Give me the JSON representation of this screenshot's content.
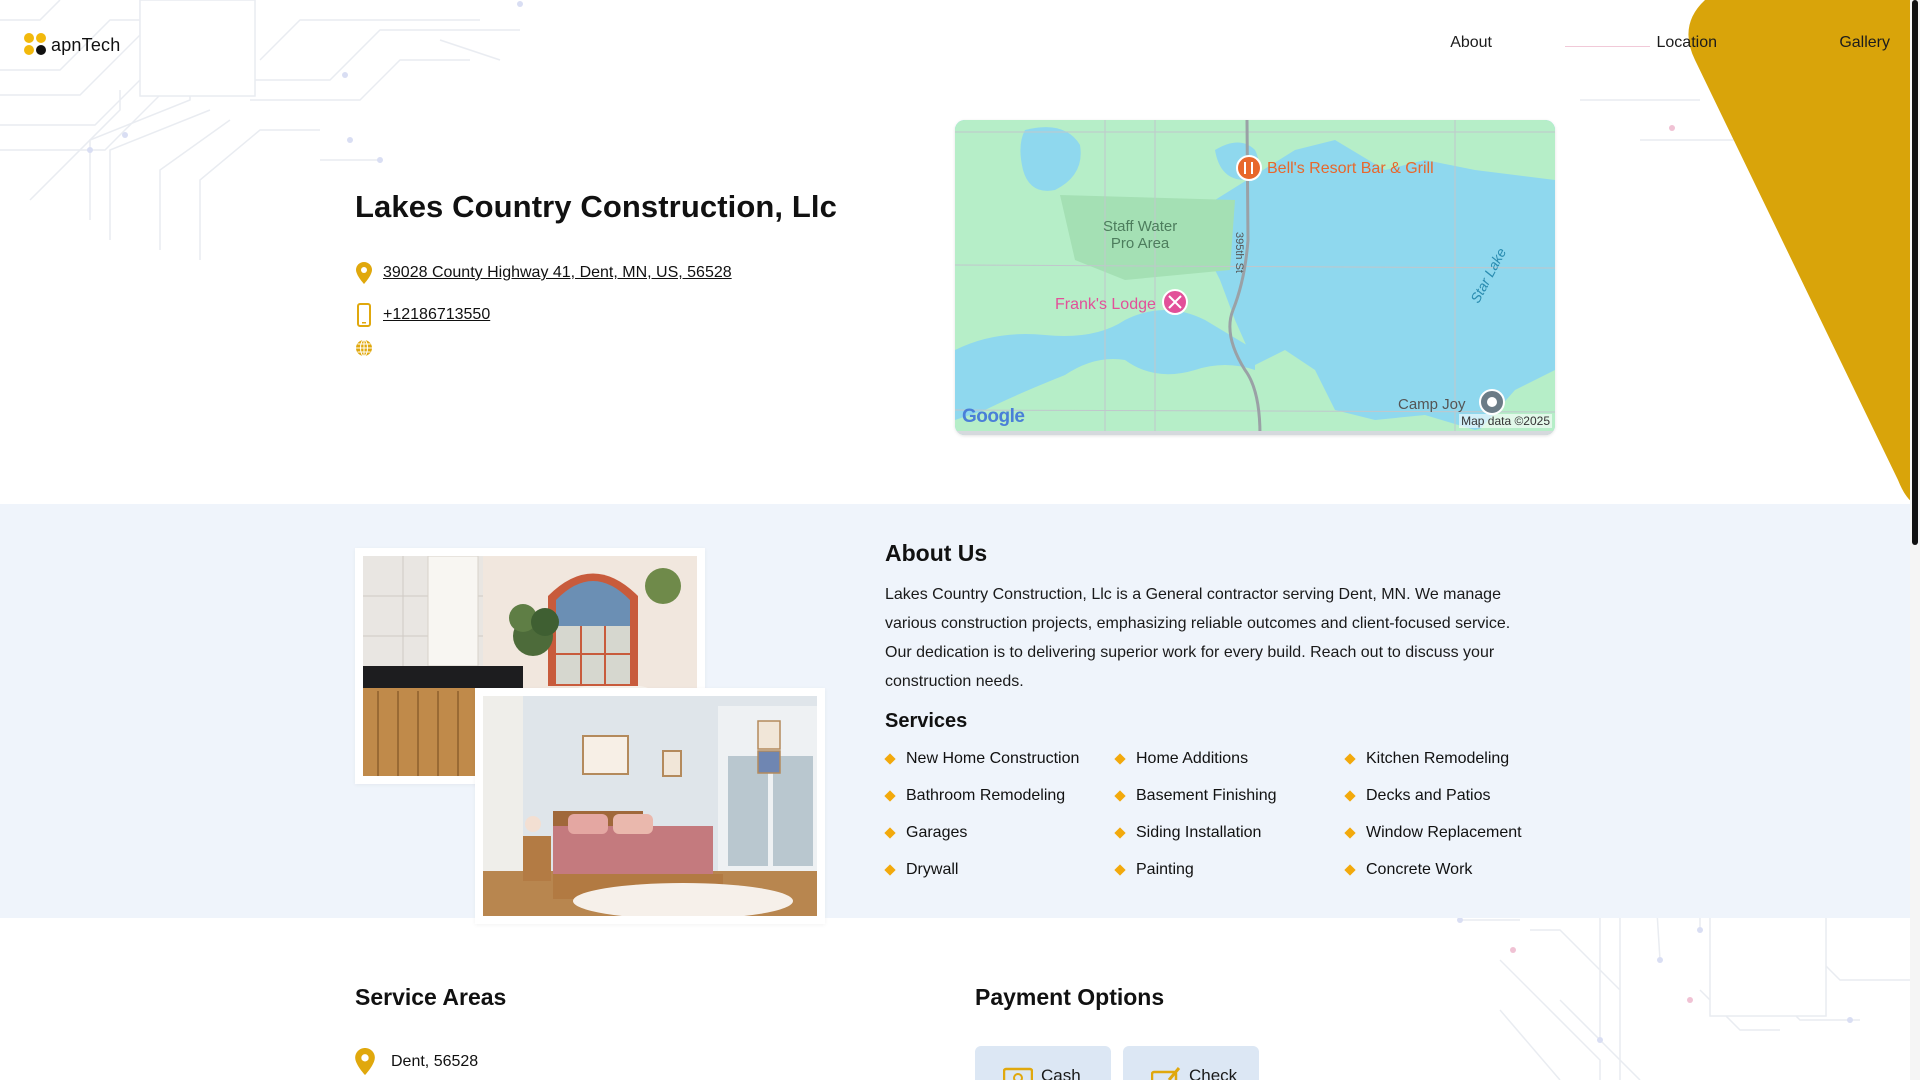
{
  "header": {
    "logo_text": "apnTech",
    "nav": {
      "about": "About",
      "location": "Location",
      "gallery": "Gallery"
    }
  },
  "business": {
    "name": "Lakes Country Construction, Llc",
    "address": "39028 County Highway 41, Dent, MN, US, 56528",
    "phone": "+12186713550",
    "icons": {
      "address": "map-pin-icon",
      "phone": "mobile-phone-icon",
      "website": "globe-icon"
    }
  },
  "map": {
    "labels": {
      "bell": "Bell's Resort Bar & Grill",
      "frank": "Frank's Lodge",
      "staff_line1": "Staff Water",
      "staff_line2": "Pro Area",
      "road": "395th St",
      "star": "Star Lake",
      "camp": "Camp Joy",
      "google": "Google",
      "map_data": "Map data ©2025"
    }
  },
  "about": {
    "title": "About Us",
    "text": "Lakes Country Construction, Llc is a General contractor serving Dent, MN. We manage various construction projects, emphasizing reliable outcomes and client-focused service. Our dedication is to delivering superior work for every build. Reach out to discuss your construction needs.",
    "services_title": "Services",
    "services": [
      "New Home Construction",
      "Home Additions",
      "Kitchen Remodeling",
      "Bathroom Remodeling",
      "Basement Finishing",
      "Decks and Patios",
      "Garages",
      "Siding Installation",
      "Window Replacement",
      "Drywall",
      "Painting",
      "Concrete Work"
    ]
  },
  "service_areas": {
    "title": "Service Areas",
    "items": [
      "Dent, 56528"
    ]
  },
  "payment": {
    "title": "Payment Options",
    "options": [
      "Cash",
      "Check"
    ]
  },
  "colors": {
    "accent": "#f2b90c",
    "corner": "#d9a40a",
    "band": "#eff4fb",
    "pay_button": "#dce7f4"
  }
}
